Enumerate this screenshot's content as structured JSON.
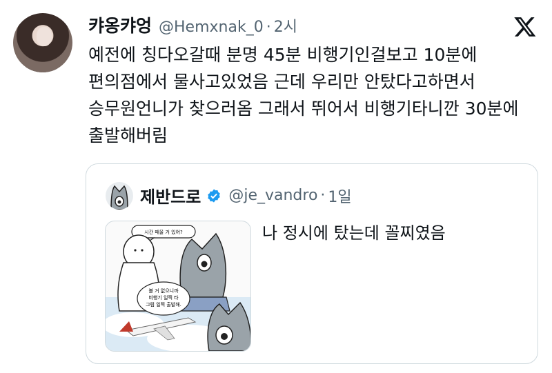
{
  "tweet": {
    "display_name": "캬옹캬엉",
    "handle": "@Hemxnak_0",
    "separator": "·",
    "time": "2시",
    "text": "예전에 칭다오갈때 분명 45분 비행기인걸보고 10분에 편의점에서 물사고있었음 근데 우리만 안탔다고하면서 승무원언니가 찾으러옴 그래서 뛰어서 비행기타니깐 30분에 출발해버림"
  },
  "quote": {
    "display_name": "제반드로",
    "handle": "@je_vandro",
    "separator": "·",
    "time": "1일",
    "text": "나 정시에 탔는데 꼴찌였음",
    "image": {
      "bubble_top": "시간 때울 거 있어?",
      "bubble_bottom_line1": "볼 거 없으니까",
      "bubble_bottom_line2": "비행기 일찍 타",
      "bubble_bottom_line3": "그럼 일찍 출발해."
    }
  },
  "icons": {
    "x_logo": "x-logo-icon",
    "verified": "verified-badge-icon"
  },
  "colors": {
    "verified_blue": "#1d9bf0",
    "secondary_text": "#536471",
    "border": "#cfd9de"
  }
}
